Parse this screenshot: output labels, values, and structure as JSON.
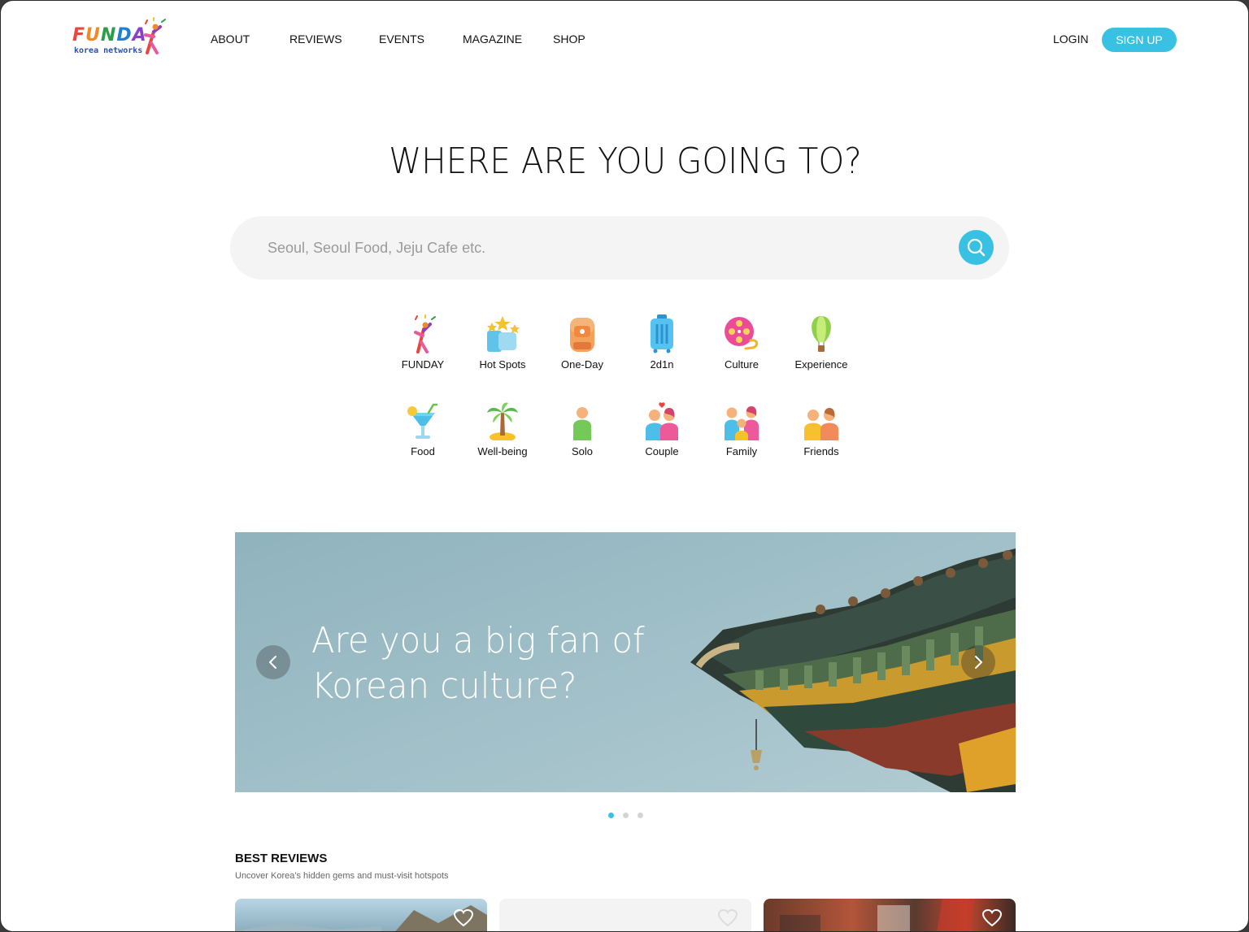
{
  "brand": {
    "name": "FUNDAY",
    "letters": [
      "F",
      "U",
      "N",
      "D",
      "A"
    ],
    "subtitle": "korea networks"
  },
  "nav": {
    "items": [
      {
        "label": "ABOUT"
      },
      {
        "label": "REVIEWS"
      },
      {
        "label": "EVENTS"
      },
      {
        "label": "MAGAZINE"
      },
      {
        "label": "SHOP"
      }
    ],
    "login": "LOGIN",
    "signup": "SIGN UP"
  },
  "hero": {
    "title": "WHERE ARE YOU GOING TO?"
  },
  "search": {
    "placeholder": "Seoul, Seoul Food, Jeju Cafe etc.",
    "value": "",
    "icon": "search-icon"
  },
  "categories": [
    {
      "label": "FUNDAY",
      "icon": "funday-figure-icon"
    },
    {
      "label": "Hot Spots",
      "icon": "stars-icon"
    },
    {
      "label": "One-Day",
      "icon": "backpack-icon"
    },
    {
      "label": "2d1n",
      "icon": "suitcase-icon"
    },
    {
      "label": "Culture",
      "icon": "film-reel-icon"
    },
    {
      "label": "Experience",
      "icon": "hot-air-balloon-icon"
    },
    {
      "label": "Food",
      "icon": "cocktail-icon"
    },
    {
      "label": "Well-being",
      "icon": "palm-tree-icon"
    },
    {
      "label": "Solo",
      "icon": "person-icon"
    },
    {
      "label": "Couple",
      "icon": "couple-icon"
    },
    {
      "label": "Family",
      "icon": "family-icon"
    },
    {
      "label": "Friends",
      "icon": "friends-icon"
    }
  ],
  "banner": {
    "line1": "Are you a big fan of",
    "line2": "Korean culture?",
    "slides": 3,
    "active_slide": 1
  },
  "reviews": {
    "title": "BEST REVIEWS",
    "subtitle": "Uncover Korea's hidden gems and must-visit hotspots"
  },
  "colors": {
    "accent": "#39c1e4",
    "search_bg": "#f4f4f4"
  }
}
